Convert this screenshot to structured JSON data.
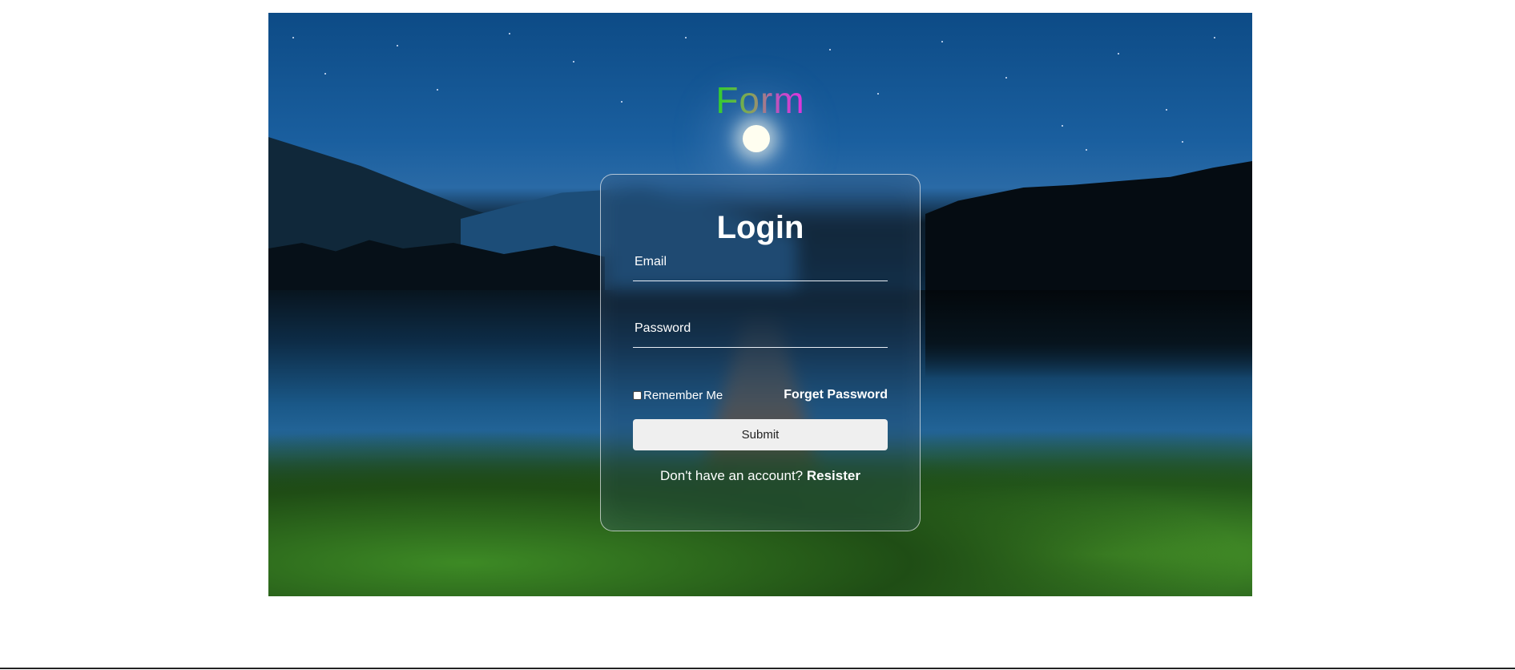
{
  "logo": {
    "text": "Form"
  },
  "login": {
    "title": "Login",
    "email_placeholder": "Email",
    "password_placeholder": "Password",
    "remember_label": "Remember Me",
    "remember_checked": false,
    "forget_label": "Forget Password",
    "submit_label": "Submit",
    "no_account_text": "Don't have an account?",
    "register_label": "Resister"
  },
  "colors": {
    "logo_gradient_start": "#2bd12b",
    "logo_gradient_end": "#e032e0",
    "submit_bg": "#efefef",
    "page_bg": "#ffffff"
  }
}
